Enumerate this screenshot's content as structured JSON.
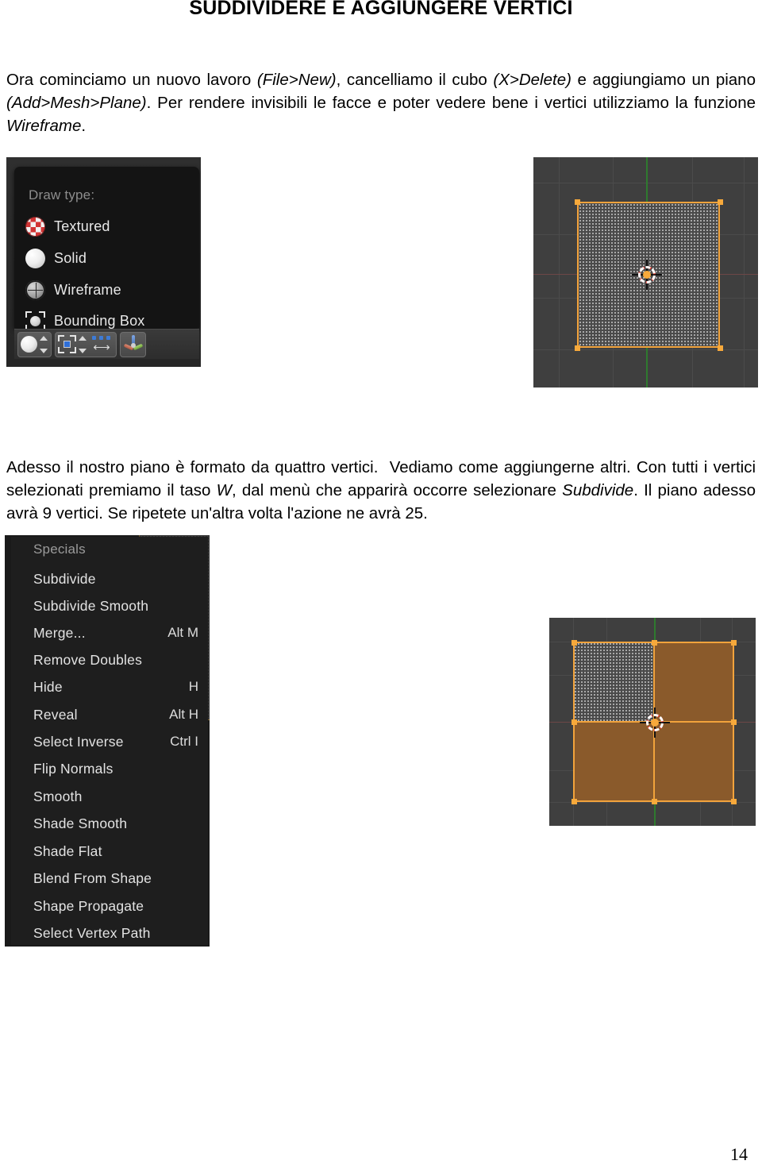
{
  "document": {
    "title": "SUDDIVIDERE E AGGIUNGERE VERTICI",
    "paragraph_1_html": "Ora cominciamo un nuovo lavoro <i>(File&gt;New)</i>, cancelliamo il cubo <i>(X&gt;Delete)</i> e aggiungiamo un piano <i>(Add&gt;Mesh&gt;Plane)</i>. Per rendere invisibili le facce e poter vedere bene i vertici utilizziamo la funzione <i>Wireframe</i>.",
    "paragraph_2_html": "Adesso il nostro piano è formato da quattro vertici.&nbsp; Vediamo come aggiungerne altri. Con tutti i vertici selezionati premiamo il taso <i>W</i>, dal menù che apparirà occorre selezionare <i>Subdivide</i>. Il piano adesso avrà 9 vertici. Se ripetete un'altra volta l'azione ne avrà 25.",
    "page_number": "14"
  },
  "draw_type_panel": {
    "title": "Draw type:",
    "items": [
      {
        "label": "Textured",
        "icon": "textured-sphere-icon"
      },
      {
        "label": "Solid",
        "icon": "solid-sphere-icon"
      },
      {
        "label": "Wireframe",
        "icon": "wireframe-sphere-icon"
      },
      {
        "label": "Bounding Box",
        "icon": "bounding-box-icon"
      }
    ],
    "toolbar": {
      "draw_type_icon": "solid-sphere-icon",
      "pivot_icon": "bounding-box-pivot-icon",
      "manipulator_icon": "translate-arrows-icon",
      "axes_icon": "transform-axes-icon"
    }
  },
  "viewport_top": {
    "selection_color": "#f2a33c",
    "background_color": "#3f3f3f",
    "y_axis_color": "#2f7a2f",
    "x_axis_color": "#6d4747",
    "plane_state": "single face, 4 vertices selected, wireframe shading",
    "vertex_count": 4
  },
  "specials_menu": {
    "header": "Specials",
    "items": [
      {
        "label": "Subdivide",
        "shortcut": ""
      },
      {
        "label": "Subdivide Smooth",
        "shortcut": ""
      },
      {
        "label": "Merge...",
        "shortcut": "Alt M"
      },
      {
        "label": "Remove Doubles",
        "shortcut": ""
      },
      {
        "label": "Hide",
        "shortcut": "H"
      },
      {
        "label": "Reveal",
        "shortcut": "Alt H"
      },
      {
        "label": "Select Inverse",
        "shortcut": "Ctrl I"
      },
      {
        "label": "Flip Normals",
        "shortcut": ""
      },
      {
        "label": "Smooth",
        "shortcut": ""
      },
      {
        "label": "Shade Smooth",
        "shortcut": ""
      },
      {
        "label": "Shade Flat",
        "shortcut": ""
      },
      {
        "label": "Blend From Shape",
        "shortcut": ""
      },
      {
        "label": "Shape Propagate",
        "shortcut": ""
      },
      {
        "label": "Select Vertex Path",
        "shortcut": ""
      }
    ]
  },
  "viewport_bottom": {
    "selection_color": "#f2a33c",
    "face_color": "#8a5a2b",
    "background_color": "#3f3f3f",
    "plane_state": "subdivided into 4 faces, 9 vertices selected",
    "vertex_count": 9
  }
}
